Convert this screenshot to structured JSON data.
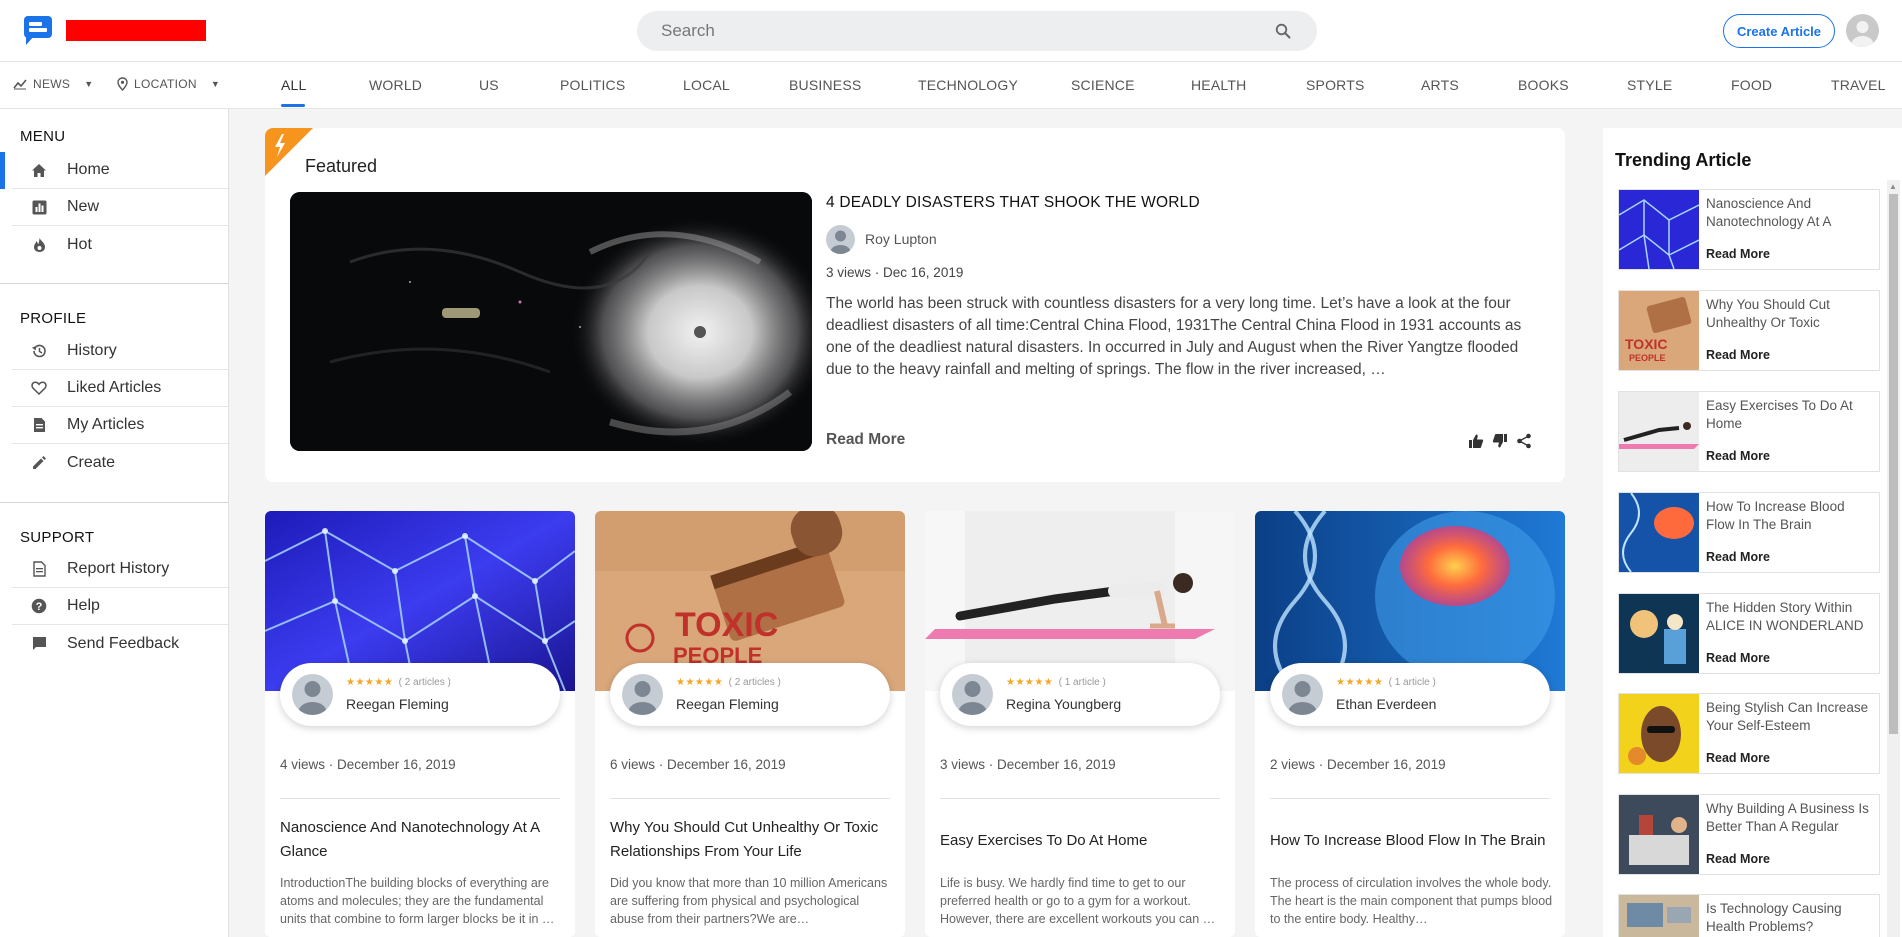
{
  "header": {
    "search_placeholder": "Search",
    "create_label": "Create Article"
  },
  "filters": {
    "news_label": "NEWS",
    "location_label": "LOCATION"
  },
  "categories": [
    "ALL",
    "WORLD",
    "US",
    "POLITICS",
    "LOCAL",
    "BUSINESS",
    "TECHNOLOGY",
    "SCIENCE",
    "HEALTH",
    "SPORTS",
    "ARTS",
    "BOOKS",
    "STYLE",
    "FOOD",
    "TRAVEL"
  ],
  "sidebar": {
    "menu_heading": "MENU",
    "menu": [
      "Home",
      "New",
      "Hot"
    ],
    "profile_heading": "PROFILE",
    "profile": [
      "History",
      "Liked Articles",
      "My Articles",
      "Create"
    ],
    "support_heading": "SUPPORT",
    "support": [
      "Report History",
      "Help",
      "Send Feedback"
    ]
  },
  "featured": {
    "label": "Featured",
    "title": "4 DEADLY DISASTERS THAT SHOOK THE WORLD",
    "author": "Roy Lupton",
    "views": "3 views",
    "date": "Dec 16, 2019",
    "description": "The world has been struck with countless disasters for a very long time. Let’s have a look at the four deadliest disasters of all time:Central China Flood, 1931The Central China Flood in 1931 accounts as one of the deadliest natural disasters. In occurred in July and August when the River Yangtze flooded due to the heavy rainfall and melting of springs. The flow in the river increased, …",
    "read_more": "Read More"
  },
  "cards": [
    {
      "author": "Reegan Fleming",
      "stars": "★★★★★",
      "count": "( 2 articles )",
      "meta": "4 views · December 16, 2019",
      "title": "Nanoscience And Nanotechnology At A Glance",
      "desc": "IntroductionThe building blocks of everything are atoms and molecules; they are the fundamental units that combine to form larger blocks be it in …"
    },
    {
      "author": "Reegan Fleming",
      "stars": "★★★★★",
      "count": "( 2 articles )",
      "meta": "6 views · December 16, 2019",
      "title": "Why You Should Cut Unhealthy Or Toxic Relationships From Your Life",
      "desc": "Did you know that more than 10 million Americans are suffering from physical and psychological abuse from their partners?We are…"
    },
    {
      "author": "Regina Youngberg",
      "stars": "★★★★★",
      "count": "( 1 article )",
      "meta": "3 views · December 16, 2019",
      "title": "Easy Exercises To Do At Home",
      "desc": "Life is busy. We hardly find time to get to our preferred health or go to a gym for a workout. However, there are excellent workouts you can …"
    },
    {
      "author": "Ethan Everdeen",
      "stars": "★★★★★",
      "count": "( 1 article )",
      "meta": "2 views · December 16, 2019",
      "title": "How To Increase Blood Flow In The Brain",
      "desc": "The process of circulation involves the whole body. The heart is the main component that pumps blood to the entire body. Healthy…"
    }
  ],
  "trending": {
    "title": "Trending Article",
    "read_more": "Read More",
    "items": [
      "Nanoscience And Nanotechnology At A",
      "Why You Should Cut Unhealthy Or Toxic",
      "Easy Exercises To Do At Home",
      "How To Increase Blood Flow In The Brain",
      "The Hidden Story Within ALICE IN WONDERLAND",
      "Being Stylish Can Increase Your Self-Esteem",
      "Why Building A Business Is Better Than A Regular",
      "Is Technology Causing Health Problems?"
    ]
  },
  "colors": {
    "accent": "#1a73e8",
    "featured_ribbon": "#f7941d",
    "stars": "#f5a623"
  }
}
